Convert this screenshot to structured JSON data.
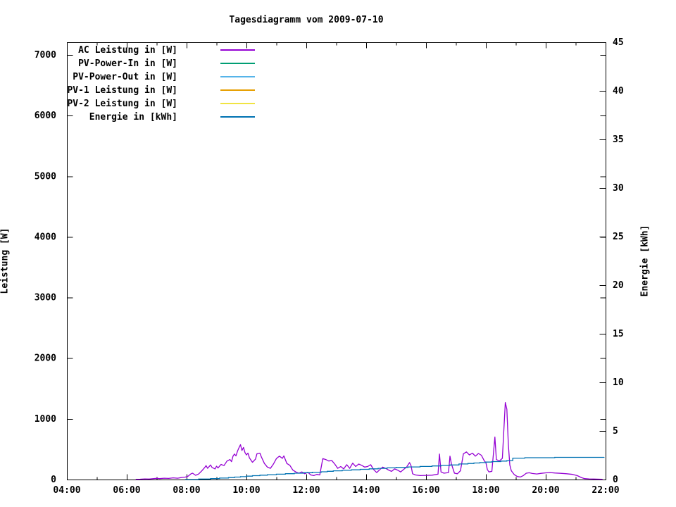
{
  "title": "Tagesdiagramm vom 2009-07-10",
  "colors": {
    "background": "#ffffff",
    "axis": "#000000",
    "text": "#000000"
  },
  "chart_data": {
    "type": "line",
    "title": "Tagesdiagramm vom 2009-07-10",
    "grid": false,
    "legend_position": "top-left-inside",
    "x_axis": {
      "unit": "time of day",
      "start_hour": 4,
      "end_hour": 22,
      "major_ticks": [
        {
          "hour": 4,
          "label": "04:00"
        },
        {
          "hour": 6,
          "label": "06:00"
        },
        {
          "hour": 8,
          "label": "08:00"
        },
        {
          "hour": 10,
          "label": "10:00"
        },
        {
          "hour": 12,
          "label": "12:00"
        },
        {
          "hour": 14,
          "label": "14:00"
        },
        {
          "hour": 16,
          "label": "16:00"
        },
        {
          "hour": 18,
          "label": "18:00"
        },
        {
          "hour": 20,
          "label": "20:00"
        },
        {
          "hour": 22,
          "label": "22:00"
        }
      ],
      "minor_tick_hours": [
        5,
        7,
        9,
        11,
        13,
        15,
        17,
        19,
        21
      ]
    },
    "y_left_axis": {
      "label": "Leistung [W]",
      "min": 0,
      "max_tick": 7000,
      "display_max": 7210,
      "tick_step": 1000,
      "ticks": [
        0,
        1000,
        2000,
        3000,
        4000,
        5000,
        6000,
        7000
      ],
      "tick_labels": [
        "0",
        "1000",
        "2000",
        "3000",
        "4000",
        "5000",
        "6000",
        "7000"
      ]
    },
    "y_right_axis": {
      "label": "Energie [kWh]",
      "min": 0,
      "max": 45,
      "tick_step": 5,
      "ticks": [
        0,
        5,
        10,
        15,
        20,
        25,
        30,
        35,
        40,
        45
      ],
      "tick_labels": [
        "0",
        "5",
        "10",
        "15",
        "20",
        "25",
        "30",
        "35",
        "40",
        "45"
      ]
    },
    "series": [
      {
        "id": "ac_leistung",
        "label": "AC Leistung in [W]",
        "color": "#9400d3",
        "axis": "left",
        "style": "line",
        "points": [
          [
            6.3,
            3
          ],
          [
            6.45,
            6
          ],
          [
            6.6,
            10
          ],
          [
            6.75,
            8
          ],
          [
            6.9,
            15
          ],
          [
            7.0,
            20
          ],
          [
            7.1,
            15
          ],
          [
            7.25,
            22
          ],
          [
            7.4,
            18
          ],
          [
            7.55,
            28
          ],
          [
            7.7,
            22
          ],
          [
            7.85,
            35
          ],
          [
            7.95,
            40
          ],
          [
            8.05,
            55
          ],
          [
            8.15,
            95
          ],
          [
            8.2,
            105
          ],
          [
            8.3,
            70
          ],
          [
            8.4,
            90
          ],
          [
            8.5,
            140
          ],
          [
            8.6,
            195
          ],
          [
            8.65,
            230
          ],
          [
            8.7,
            185
          ],
          [
            8.8,
            240
          ],
          [
            8.85,
            200
          ],
          [
            8.95,
            175
          ],
          [
            9.0,
            220
          ],
          [
            9.05,
            190
          ],
          [
            9.15,
            250
          ],
          [
            9.25,
            230
          ],
          [
            9.35,
            305
          ],
          [
            9.45,
            330
          ],
          [
            9.5,
            295
          ],
          [
            9.55,
            385
          ],
          [
            9.6,
            420
          ],
          [
            9.65,
            390
          ],
          [
            9.7,
            465
          ],
          [
            9.75,
            525
          ],
          [
            9.8,
            575
          ],
          [
            9.85,
            480
          ],
          [
            9.9,
            530
          ],
          [
            9.95,
            445
          ],
          [
            10.0,
            405
          ],
          [
            10.05,
            435
          ],
          [
            10.1,
            355
          ],
          [
            10.2,
            285
          ],
          [
            10.3,
            335
          ],
          [
            10.35,
            425
          ],
          [
            10.45,
            435
          ],
          [
            10.5,
            370
          ],
          [
            10.6,
            265
          ],
          [
            10.7,
            205
          ],
          [
            10.8,
            185
          ],
          [
            10.9,
            255
          ],
          [
            11.0,
            345
          ],
          [
            11.1,
            385
          ],
          [
            11.2,
            350
          ],
          [
            11.25,
            390
          ],
          [
            11.35,
            265
          ],
          [
            11.45,
            235
          ],
          [
            11.55,
            155
          ],
          [
            11.65,
            125
          ],
          [
            11.75,
            105
          ],
          [
            11.85,
            125
          ],
          [
            11.95,
            95
          ],
          [
            12.05,
            120
          ],
          [
            12.15,
            75
          ],
          [
            12.25,
            65
          ],
          [
            12.35,
            85
          ],
          [
            12.45,
            75
          ],
          [
            12.55,
            345
          ],
          [
            12.65,
            330
          ],
          [
            12.75,
            305
          ],
          [
            12.85,
            315
          ],
          [
            12.95,
            255
          ],
          [
            13.05,
            185
          ],
          [
            13.15,
            215
          ],
          [
            13.25,
            175
          ],
          [
            13.35,
            245
          ],
          [
            13.45,
            185
          ],
          [
            13.55,
            270
          ],
          [
            13.65,
            215
          ],
          [
            13.75,
            255
          ],
          [
            13.85,
            235
          ],
          [
            13.95,
            205
          ],
          [
            14.05,
            215
          ],
          [
            14.15,
            245
          ],
          [
            14.25,
            165
          ],
          [
            14.35,
            115
          ],
          [
            14.45,
            160
          ],
          [
            14.55,
            205
          ],
          [
            14.65,
            185
          ],
          [
            14.75,
            155
          ],
          [
            14.85,
            135
          ],
          [
            14.95,
            175
          ],
          [
            15.05,
            155
          ],
          [
            15.15,
            125
          ],
          [
            15.25,
            165
          ],
          [
            15.35,
            205
          ],
          [
            15.45,
            280
          ],
          [
            15.5,
            225
          ],
          [
            15.55,
            95
          ],
          [
            15.65,
            75
          ],
          [
            15.8,
            65
          ],
          [
            16.0,
            68
          ],
          [
            16.2,
            72
          ],
          [
            16.4,
            88
          ],
          [
            16.45,
            420
          ],
          [
            16.5,
            125
          ],
          [
            16.6,
            105
          ],
          [
            16.75,
            115
          ],
          [
            16.8,
            385
          ],
          [
            16.85,
            255
          ],
          [
            16.95,
            105
          ],
          [
            17.05,
            95
          ],
          [
            17.15,
            145
          ],
          [
            17.25,
            425
          ],
          [
            17.35,
            455
          ],
          [
            17.45,
            405
          ],
          [
            17.55,
            435
          ],
          [
            17.65,
            385
          ],
          [
            17.75,
            430
          ],
          [
            17.85,
            400
          ],
          [
            17.95,
            305
          ],
          [
            18.0,
            280
          ],
          [
            18.05,
            165
          ],
          [
            18.1,
            125
          ],
          [
            18.2,
            135
          ],
          [
            18.3,
            700
          ],
          [
            18.35,
            330
          ],
          [
            18.45,
            305
          ],
          [
            18.55,
            350
          ],
          [
            18.65,
            1270
          ],
          [
            18.7,
            1160
          ],
          [
            18.75,
            580
          ],
          [
            18.8,
            240
          ],
          [
            18.85,
            145
          ],
          [
            18.95,
            80
          ],
          [
            19.05,
            50
          ],
          [
            19.15,
            42
          ],
          [
            19.25,
            65
          ],
          [
            19.35,
            105
          ],
          [
            19.45,
            112
          ],
          [
            19.55,
            100
          ],
          [
            19.7,
            92
          ],
          [
            19.85,
            102
          ],
          [
            20.0,
            110
          ],
          [
            20.15,
            115
          ],
          [
            20.3,
            108
          ],
          [
            20.5,
            102
          ],
          [
            20.7,
            95
          ],
          [
            20.9,
            85
          ],
          [
            21.05,
            65
          ],
          [
            21.2,
            30
          ],
          [
            21.3,
            15
          ],
          [
            21.45,
            10
          ],
          [
            21.6,
            8
          ],
          [
            21.9,
            5
          ]
        ]
      },
      {
        "id": "pv_power_in",
        "label": "PV-Power-In in [W]",
        "color": "#009e73",
        "axis": "left",
        "style": "line",
        "points": [],
        "note": "not visible in plot area (flat at 0)"
      },
      {
        "id": "pv_power_out",
        "label": "PV-Power-Out in [W]",
        "color": "#56b4e9",
        "axis": "left",
        "style": "line",
        "points": [],
        "note": "not visible in plot area (flat at 0)"
      },
      {
        "id": "pv1_leistung",
        "label": "PV-1 Leistung in [W]",
        "color": "#e69f00",
        "axis": "left",
        "style": "line",
        "points": [],
        "note": "not visible in plot area (flat at 0)"
      },
      {
        "id": "pv2_leistung",
        "label": "PV-2 Leistung in [W]",
        "color": "#f0e442",
        "axis": "left",
        "style": "line",
        "points": [],
        "note": "not visible in plot area (flat at 0)"
      },
      {
        "id": "energie",
        "label": "Energie in [kWh]",
        "color": "#0072b2",
        "axis": "right",
        "style": "steps",
        "points": [
          [
            7.95,
            0
          ],
          [
            8.4,
            0.05
          ],
          [
            8.8,
            0.1
          ],
          [
            9.1,
            0.15
          ],
          [
            9.4,
            0.2
          ],
          [
            9.6,
            0.25
          ],
          [
            9.8,
            0.3
          ],
          [
            10.0,
            0.35
          ],
          [
            10.2,
            0.4
          ],
          [
            10.45,
            0.45
          ],
          [
            10.7,
            0.5
          ],
          [
            11.0,
            0.55
          ],
          [
            11.3,
            0.6
          ],
          [
            11.6,
            0.65
          ],
          [
            11.9,
            0.7
          ],
          [
            12.2,
            0.75
          ],
          [
            12.5,
            0.8
          ],
          [
            12.7,
            0.85
          ],
          [
            12.9,
            0.9
          ],
          [
            13.2,
            0.95
          ],
          [
            13.5,
            1.0
          ],
          [
            13.8,
            1.05
          ],
          [
            14.1,
            1.1
          ],
          [
            14.4,
            1.15
          ],
          [
            14.7,
            1.2
          ],
          [
            15.0,
            1.25
          ],
          [
            15.4,
            1.3
          ],
          [
            15.8,
            1.35
          ],
          [
            16.2,
            1.4
          ],
          [
            16.5,
            1.45
          ],
          [
            16.8,
            1.5
          ],
          [
            17.1,
            1.6
          ],
          [
            17.4,
            1.65
          ],
          [
            17.6,
            1.7
          ],
          [
            17.8,
            1.75
          ],
          [
            18.0,
            1.8
          ],
          [
            18.2,
            1.85
          ],
          [
            18.5,
            1.9
          ],
          [
            18.7,
            1.95
          ],
          [
            18.9,
            2.2
          ],
          [
            19.3,
            2.25
          ],
          [
            20.3,
            2.28
          ],
          [
            21.95,
            2.3
          ]
        ]
      }
    ]
  }
}
